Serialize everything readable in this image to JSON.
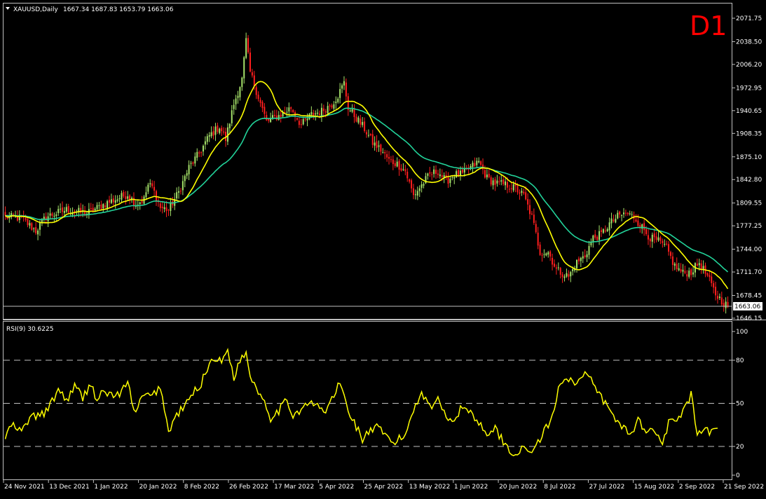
{
  "window": {
    "symbol_caption": "XAUUSD,Daily",
    "ohlc_caption": "1667.34 1687.83 1653.79 1663.06",
    "timeframe_badge": "D1",
    "colors": {
      "background": "#000000",
      "frame": "#c0c0c0",
      "bull_candle": "#a6e36a",
      "bear_candle": "#ff1e1e",
      "ma_fast": "#ffff00",
      "ma_slow": "#22d39a",
      "rsi_line": "#ffff00",
      "badge": "#ff0000",
      "price_line": "#c0c0c0"
    }
  },
  "chart_data": [
    {
      "type": "candlestick",
      "title": "XAUUSD,Daily",
      "ylim": [
        1646.15,
        2071.75
      ],
      "y_ticks": [
        "2071.75",
        "2038.50",
        "2006.20",
        "1972.95",
        "1940.65",
        "1908.35",
        "1875.10",
        "1842.80",
        "1809.55",
        "1777.25",
        "1744.00",
        "1711.70",
        "1678.45",
        "1646.15"
      ],
      "current_price_label": "1663.06",
      "current_price": 1663.06,
      "x_labels": [
        "24 Nov 2021",
        "13 Dec 2021",
        "1 Jan 2022",
        "20 Jan 2022",
        "8 Feb 2022",
        "26 Feb 2022",
        "17 Mar 2022",
        "5 Apr 2022",
        "25 Apr 2022",
        "13 May 2022",
        "1 Jun 2022",
        "20 Jun 2022",
        "8 Jul 2022",
        "27 Jul 2022",
        "15 Aug 2022",
        "2 Sep 2022",
        "21 Sep 2022"
      ],
      "close_keypoints": [
        [
          0,
          1790
        ],
        [
          8,
          1788
        ],
        [
          15,
          1770
        ],
        [
          20,
          1790
        ],
        [
          30,
          1800
        ],
        [
          40,
          1795
        ],
        [
          50,
          1810
        ],
        [
          60,
          1822
        ],
        [
          64,
          1808
        ],
        [
          68,
          1815
        ],
        [
          70,
          1835
        ],
        [
          72,
          1832
        ],
        [
          76,
          1803
        ],
        [
          80,
          1800
        ],
        [
          85,
          1825
        ],
        [
          90,
          1860
        ],
        [
          95,
          1880
        ],
        [
          100,
          1905
        ],
        [
          105,
          1918
        ],
        [
          108,
          1900
        ],
        [
          112,
          1950
        ],
        [
          116,
          1985
        ],
        [
          118,
          2040
        ],
        [
          120,
          1995
        ],
        [
          124,
          1960
        ],
        [
          128,
          1925
        ],
        [
          135,
          1935
        ],
        [
          140,
          1945
        ],
        [
          145,
          1920
        ],
        [
          150,
          1935
        ],
        [
          155,
          1940
        ],
        [
          160,
          1950
        ],
        [
          163,
          1962
        ],
        [
          166,
          1980
        ],
        [
          168,
          1945
        ],
        [
          172,
          1930
        ],
        [
          176,
          1915
        ],
        [
          180,
          1895
        ],
        [
          184,
          1885
        ],
        [
          188,
          1870
        ],
        [
          192,
          1865
        ],
        [
          196,
          1855
        ],
        [
          200,
          1820
        ],
        [
          204,
          1835
        ],
        [
          208,
          1850
        ],
        [
          212,
          1855
        ],
        [
          216,
          1840
        ],
        [
          220,
          1850
        ],
        [
          224,
          1850
        ],
        [
          228,
          1860
        ],
        [
          232,
          1868
        ],
        [
          236,
          1845
        ],
        [
          240,
          1838
        ],
        [
          246,
          1835
        ],
        [
          250,
          1830
        ],
        [
          254,
          1820
        ],
        [
          258,
          1790
        ],
        [
          262,
          1740
        ],
        [
          266,
          1740
        ],
        [
          270,
          1715
        ],
        [
          276,
          1705
        ],
        [
          280,
          1725
        ],
        [
          284,
          1735
        ],
        [
          288,
          1760
        ],
        [
          292,
          1765
        ],
        [
          296,
          1780
        ],
        [
          300,
          1790
        ],
        [
          304,
          1795
        ],
        [
          308,
          1790
        ],
        [
          312,
          1775
        ],
        [
          316,
          1760
        ],
        [
          320,
          1755
        ],
        [
          324,
          1745
        ],
        [
          328,
          1720
        ],
        [
          332,
          1710
        ],
        [
          336,
          1712
        ],
        [
          340,
          1725
        ],
        [
          344,
          1705
        ],
        [
          348,
          1680
        ],
        [
          352,
          1668
        ],
        [
          354,
          1663
        ]
      ],
      "series": [
        {
          "name": "",
          "kind": "moving-average-fast"
        },
        {
          "name": "",
          "kind": "moving-average-slow"
        }
      ]
    },
    {
      "type": "line",
      "title": "RSI(9) 30.6225",
      "ylim": [
        0,
        100
      ],
      "y_ticks": [
        "100",
        "80",
        "50",
        "20",
        "0"
      ],
      "levels": [
        80,
        50,
        20
      ],
      "rsi_keypoints": [
        [
          0,
          26
        ],
        [
          3,
          35
        ],
        [
          8,
          30
        ],
        [
          12,
          40
        ],
        [
          18,
          42
        ],
        [
          22,
          48
        ],
        [
          26,
          60
        ],
        [
          30,
          52
        ],
        [
          34,
          62
        ],
        [
          38,
          54
        ],
        [
          42,
          64
        ],
        [
          45,
          52
        ],
        [
          48,
          58
        ],
        [
          52,
          56
        ],
        [
          56,
          56
        ],
        [
          60,
          64
        ],
        [
          64,
          42
        ],
        [
          67,
          55
        ],
        [
          72,
          55
        ],
        [
          76,
          62
        ],
        [
          80,
          30
        ],
        [
          84,
          42
        ],
        [
          88,
          48
        ],
        [
          92,
          57
        ],
        [
          96,
          64
        ],
        [
          100,
          78
        ],
        [
          103,
          82
        ],
        [
          106,
          78
        ],
        [
          109,
          88
        ],
        [
          112,
          68
        ],
        [
          115,
          80
        ],
        [
          118,
          85
        ],
        [
          120,
          70
        ],
        [
          124,
          58
        ],
        [
          127,
          52
        ],
        [
          130,
          40
        ],
        [
          134,
          45
        ],
        [
          138,
          52
        ],
        [
          141,
          42
        ],
        [
          145,
          46
        ],
        [
          149,
          50
        ],
        [
          153,
          48
        ],
        [
          157,
          44
        ],
        [
          161,
          56
        ],
        [
          164,
          64
        ],
        [
          166,
          55
        ],
        [
          168,
          45
        ],
        [
          172,
          34
        ],
        [
          175,
          25
        ],
        [
          178,
          30
        ],
        [
          182,
          33
        ],
        [
          186,
          28
        ],
        [
          190,
          22
        ],
        [
          196,
          28
        ],
        [
          200,
          46
        ],
        [
          204,
          58
        ],
        [
          208,
          48
        ],
        [
          212,
          52
        ],
        [
          216,
          42
        ],
        [
          220,
          38
        ],
        [
          224,
          48
        ],
        [
          228,
          44
        ],
        [
          232,
          36
        ],
        [
          236,
          30
        ],
        [
          240,
          32
        ],
        [
          244,
          24
        ],
        [
          248,
          14
        ],
        [
          252,
          18
        ],
        [
          256,
          16
        ],
        [
          260,
          20
        ],
        [
          264,
          30
        ],
        [
          268,
          40
        ],
        [
          272,
          66
        ],
        [
          276,
          68
        ],
        [
          280,
          64
        ],
        [
          284,
          70
        ],
        [
          288,
          64
        ],
        [
          290,
          58
        ],
        [
          294,
          50
        ],
        [
          298,
          40
        ],
        [
          302,
          35
        ],
        [
          306,
          28
        ],
        [
          310,
          38
        ],
        [
          314,
          32
        ],
        [
          318,
          30
        ],
        [
          322,
          24
        ],
        [
          325,
          36
        ],
        [
          329,
          38
        ],
        [
          333,
          46
        ],
        [
          336,
          56
        ],
        [
          339,
          28
        ],
        [
          343,
          30
        ],
        [
          347,
          30.6
        ]
      ]
    }
  ]
}
